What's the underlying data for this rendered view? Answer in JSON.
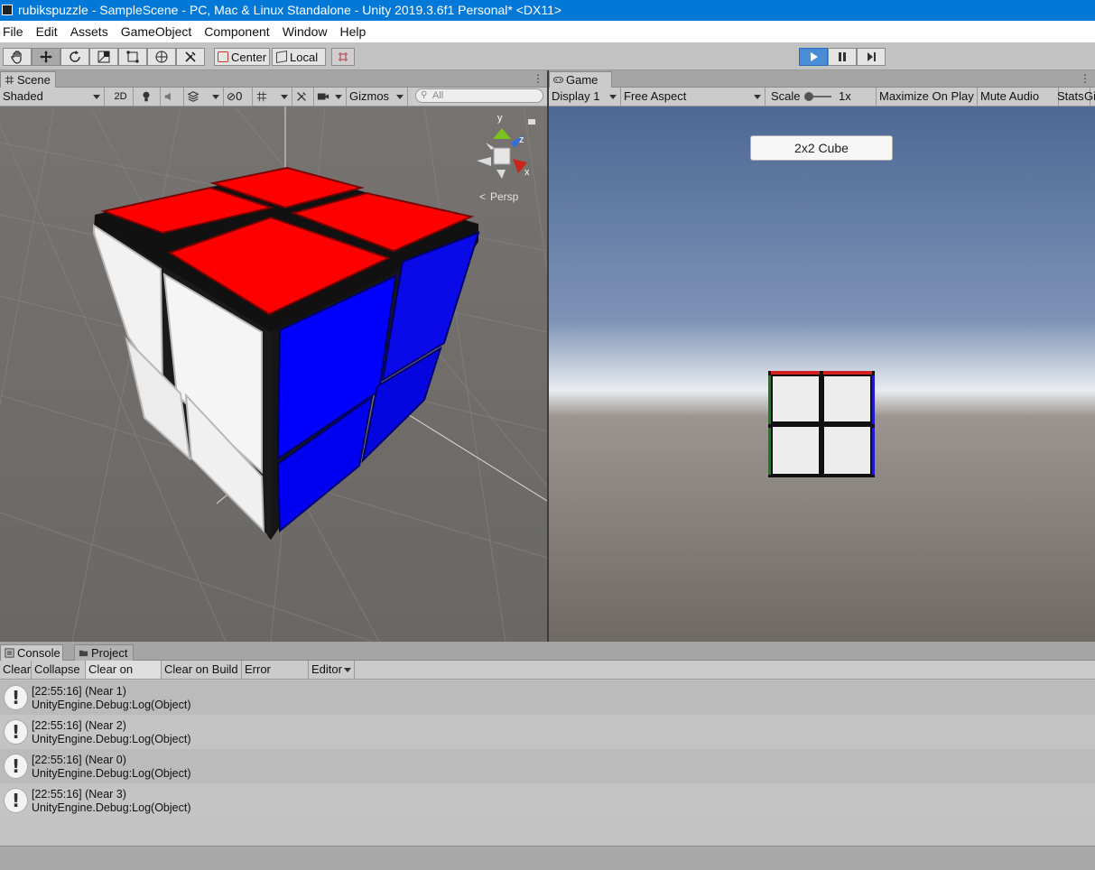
{
  "window": {
    "title": "rubikspuzzle - SampleScene - PC, Mac & Linux Standalone - Unity 2019.3.6f1 Personal* <DX11>"
  },
  "menu": [
    "File",
    "Edit",
    "Assets",
    "GameObject",
    "Component",
    "Window",
    "Help"
  ],
  "toolbar": {
    "pivot_label": "Center",
    "space_label": "Local"
  },
  "scene": {
    "tab_label": "Scene",
    "shading_mode": "Shaded",
    "mode_2d": "2D",
    "hidden_count": "0",
    "gizmos_label": "Gizmos",
    "search_placeholder": "All",
    "gizmo": {
      "x": "x",
      "y": "y",
      "z": "z",
      "persp": "Persp"
    },
    "colors": {
      "top": "#ff0000",
      "left": "#ffffff",
      "right": "#0000ff",
      "body": "#111111"
    }
  },
  "game": {
    "tab_label": "Game",
    "display": "Display 1",
    "aspect": "Free Aspect",
    "scale_label": "Scale",
    "scale_value": "1x",
    "maximize_label": "Maximize On Play",
    "mute_label": "Mute Audio",
    "stats_label": "Stats",
    "gizmos_label": "Gi:",
    "button_label": "2x2 Cube"
  },
  "bottom_tabs": {
    "console": "Console",
    "project": "Project"
  },
  "console": {
    "buttons": {
      "clear": "Clear",
      "collapse": "Collapse",
      "clear_on_play": "Clear on Play",
      "clear_on_build": "Clear on Build",
      "error_pause": "Error Pause",
      "editor": "Editor"
    },
    "logs": [
      {
        "line1": "[22:55:16] (Near 1)",
        "line2": "UnityEngine.Debug:Log(Object)"
      },
      {
        "line1": "[22:55:16] (Near 2)",
        "line2": "UnityEngine.Debug:Log(Object)"
      },
      {
        "line1": "[22:55:16] (Near 0)",
        "line2": "UnityEngine.Debug:Log(Object)"
      },
      {
        "line1": "[22:55:16] (Near 3)",
        "line2": "UnityEngine.Debug:Log(Object)"
      }
    ]
  }
}
